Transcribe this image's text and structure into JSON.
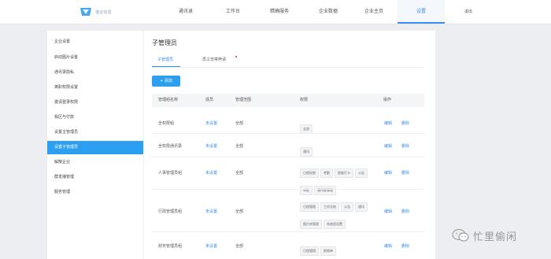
{
  "header": {
    "logo_text": "谐云信息",
    "nav": [
      "通讯录",
      "工作台",
      "精确服务",
      "企业数据",
      "企业主页",
      "设置",
      "退出"
    ],
    "active_nav": "设置"
  },
  "sidebar": {
    "items": [
      "企业设置",
      "启动图片设置",
      "通讯录隐私",
      "离职权限设置",
      "邀请登录权限",
      "我区与付款",
      "设置主管理员",
      "设置子管理员",
      "解散企业",
      "群发播管理",
      "服务管理"
    ],
    "active_index": 7
  },
  "main": {
    "title": "子管理员",
    "tabs": [
      "子管理员",
      "员工日常申请"
    ],
    "add_button": "+ 添加",
    "table": {
      "headers": [
        "管理组名称",
        "成员",
        "管理范围",
        "权限",
        "操作"
      ],
      "rows": [
        {
          "name": "全权限组",
          "members": "未设置",
          "scope": "全部",
          "perms": [
            "全部"
          ],
          "edit": "编辑",
          "delete": "删除"
        },
        {
          "name": "全权限通讯录",
          "members": "未设置",
          "scope": "全部",
          "perms": [
            "通讯"
          ],
          "edit": "编辑",
          "delete": "删除"
        },
        {
          "name": "人事管理员组",
          "members": "未设置",
          "scope": "全部",
          "perms": [
            "日程权限",
            "考勤",
            "智能打卡",
            "公告",
            "审批",
            "通讯录管理"
          ],
          "edit": "编辑",
          "delete": "删除"
        },
        {
          "name": "行政管理员组",
          "members": "未设置",
          "scope": "全部",
          "perms": [
            "日程管理",
            "工作总结",
            "公告",
            "通讯",
            "图片库管理",
            "系统权设置"
          ],
          "edit": "编辑",
          "delete": "删除"
        },
        {
          "name": "财务管理员组",
          "members": "未设置",
          "scope": "全部",
          "perms": [
            "日程管理",
            "报销单"
          ],
          "edit": "编辑",
          "delete": "删除"
        }
      ]
    }
  },
  "watermark": {
    "text": "忙里偷闲"
  },
  "colors": {
    "accent": "#2d9ff0",
    "link": "#3a8ee6",
    "background": "#eceef1"
  }
}
